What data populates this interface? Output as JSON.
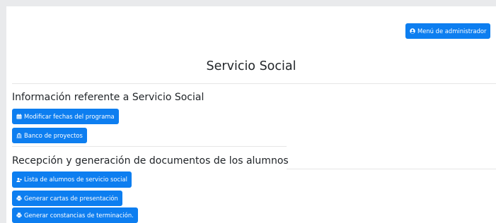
{
  "header": {
    "admin_menu_label": "Menú de administrador"
  },
  "page": {
    "title": "Servicio Social"
  },
  "sections": [
    {
      "heading": "Información referente a Servicio Social",
      "buttons": [
        {
          "label": "Modificar fechas del programa",
          "icon": "calendar-icon"
        },
        {
          "label": "Banco de proyectos",
          "icon": "bank-icon"
        }
      ]
    },
    {
      "heading": "Recepción y generación de documentos de los alumnos",
      "buttons": [
        {
          "label": "Lista de alumnos de servicio social",
          "icon": "user-plus-icon"
        },
        {
          "label": "Generar cartas de presentación",
          "icon": "printer-icon"
        },
        {
          "label": "Generar constancias de terminación.",
          "icon": "printer-icon"
        }
      ]
    }
  ],
  "colors": {
    "primary": "#0d7ef0",
    "background": "#e9eaec",
    "card": "#ffffff"
  }
}
